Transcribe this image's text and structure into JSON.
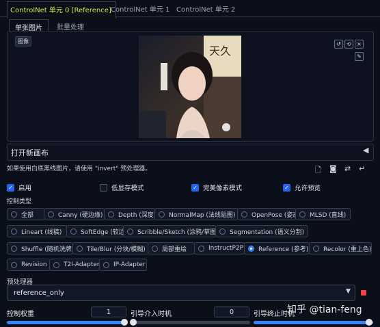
{
  "top_tabs": [
    "ControlNet 单元 0 [Reference]",
    "ControlNet 单元 1",
    "ControlNet 单元 2"
  ],
  "sub_tabs": [
    "单张图片",
    "批量处理"
  ],
  "image": {
    "label": "图像"
  },
  "canvas": {
    "label": "打开新画布"
  },
  "hint": "如果使用白底黑线图片，请使用 \"invert\" 预处理器。",
  "checkboxes": [
    {
      "label": "启用",
      "checked": true
    },
    {
      "label": "低显存模式",
      "checked": false
    },
    {
      "label": "完美像素模式",
      "checked": true
    },
    {
      "label": "允许预览",
      "checked": true
    }
  ],
  "control_type": {
    "label": "控制类型",
    "options": [
      "全部",
      "Canny (硬边缘)",
      "Depth (深度)",
      "NormalMap (法线贴图)",
      "OpenPose (姿态)",
      "MLSD (直线)",
      "Lineart (线稿)",
      "SoftEdge (软边缘)",
      "Scribble/Sketch (涂鸦/草图)",
      "Segmentation (语义分割)",
      "Shuffle (随机洗牌)",
      "Tile/Blur (分块/模糊)",
      "局部重绘",
      "InstructP2P",
      "Reference (参考)",
      "Recolor (重上色)",
      "Revision",
      "T2I-Adapter",
      "IP-Adapter"
    ],
    "selected": "Reference (参考)"
  },
  "preprocessor": {
    "label": "预处理器",
    "value": "reference_only"
  },
  "sliders": [
    {
      "label": "控制权重",
      "value": "1",
      "fraction": 1.0
    },
    {
      "label": "引导介入时机",
      "value": "0",
      "fraction": 0.0
    },
    {
      "label": "引导终止时机",
      "value": "1",
      "fraction": 1.0
    }
  ],
  "watermark": "知乎 @tian-feng",
  "colors": {
    "accent": "#3b82f6",
    "active_tab": "#d4e84f",
    "background": "#0b0f19"
  }
}
